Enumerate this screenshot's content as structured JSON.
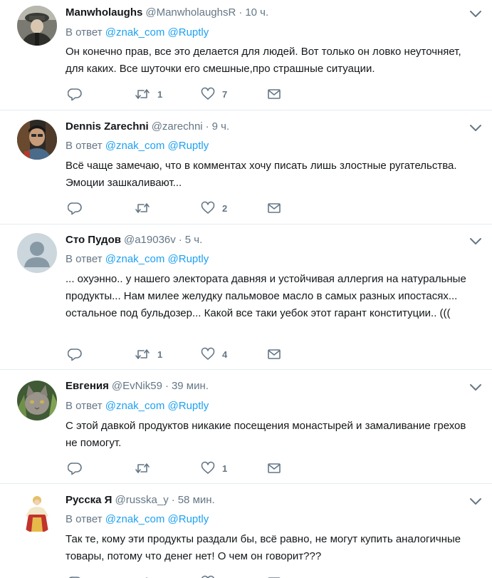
{
  "reply_prefix": "В ответ",
  "tweets": [
    {
      "name": "Manwholaughs",
      "handle": "@ManwholaughsR",
      "separator": "·",
      "time": "10 ч.",
      "mentions": [
        "@znak_com",
        "@Ruptly"
      ],
      "text": "Он конечно прав, все это делается для людей. Вот только он  ловко неуточняет, для каких. Все шуточки его смешные,про страшные ситуации.",
      "retweets": "1",
      "likes": "7",
      "avatar": "soldier-photo"
    },
    {
      "name": "Dennis Zarechni",
      "handle": "@zarechni",
      "separator": "·",
      "time": "9 ч.",
      "mentions": [
        "@znak_com",
        "@Ruptly"
      ],
      "text": "Всё чаще замечаю, что в комментах хочу писать лишь злостные ругательства. Эмоции зашкаливают...",
      "retweets": "",
      "likes": "2",
      "avatar": "man-photo"
    },
    {
      "name": "Сто Пудов",
      "handle": "@a19036v",
      "separator": "·",
      "time": "5 ч.",
      "mentions": [
        "@znak_com",
        "@Ruptly"
      ],
      "text": "... охуэнно.. у нашего электората давняя и устойчивая аллергия на натуральные продукты... Нам милее желудку пальмовое масло в самых разных ипостасях... остальное под бульдозер... Какой все таки уебок этот гарант конституции.. (((",
      "retweets": "1",
      "likes": "4",
      "avatar": "default-avatar"
    },
    {
      "name": "Евгения",
      "handle": "@EvNik59",
      "separator": "·",
      "time": "39 мин.",
      "mentions": [
        "@znak_com",
        "@Ruptly"
      ],
      "text": "С этой давкой продуктов никакие посещения монастырей и замаливание грехов не помогут.",
      "retweets": "",
      "likes": "1",
      "avatar": "cat-photo"
    },
    {
      "name": "Русска Я",
      "handle": "@russka_y",
      "separator": "·",
      "time": "58 мин.",
      "mentions": [
        "@znak_com",
        "@Ruptly"
      ],
      "text": "Так те, кому эти продукты раздали бы, всё равно, не могут купить аналогичные товары, потому что денег нет!  О чем он говорит???",
      "retweets": "",
      "likes": "",
      "avatar": "doll-photo"
    }
  ],
  "colors": {
    "text": "#14171a",
    "secondary": "#657786",
    "link": "#1da1f2",
    "divider": "#e6ecf0"
  }
}
